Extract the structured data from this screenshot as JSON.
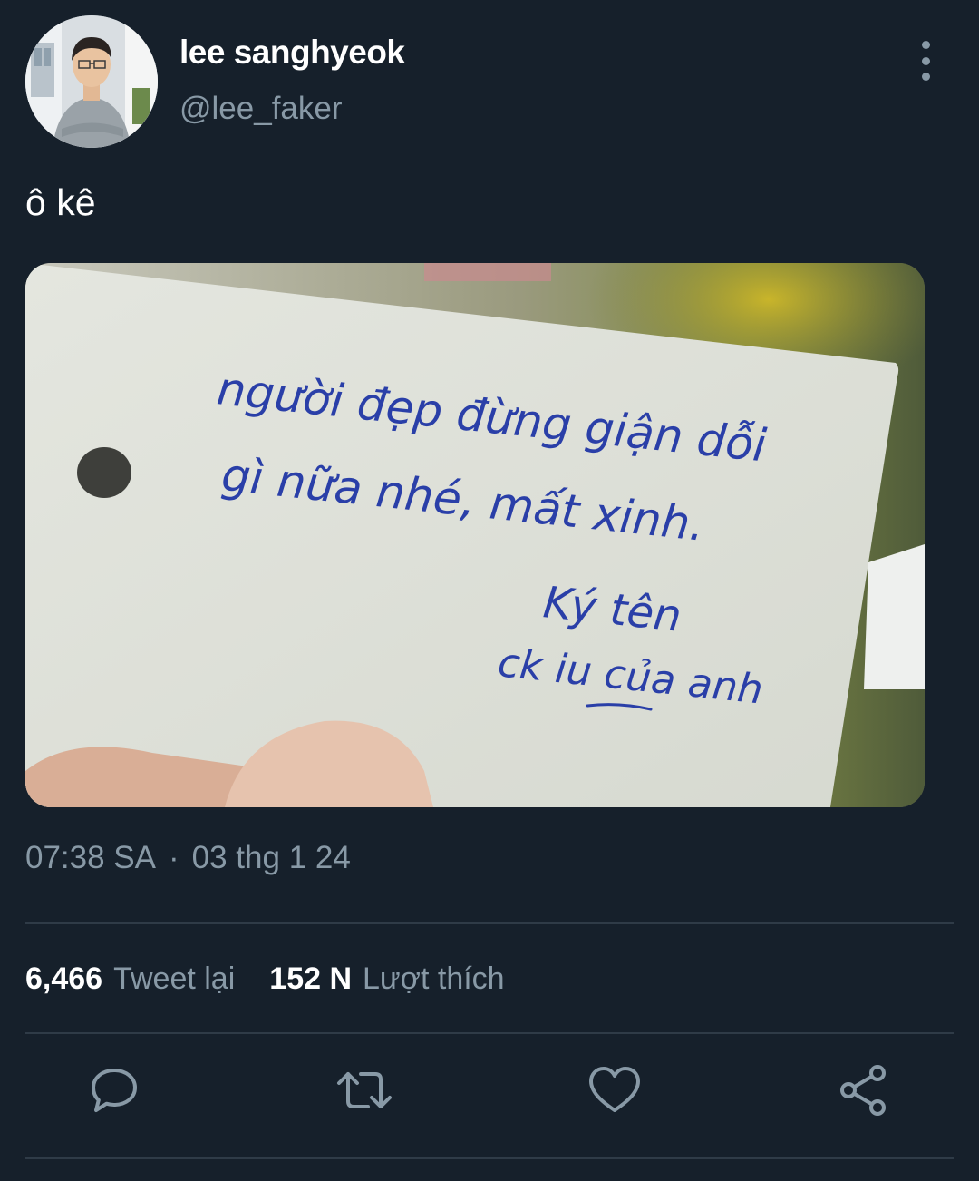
{
  "author": {
    "display_name": "lee sanghyeok",
    "handle": "@lee_faker",
    "avatar_icon": "profile-photo"
  },
  "tweet": {
    "text": "ô kê",
    "media": {
      "handwritten_note": [
        "người đẹp đừng giận dỗi",
        "gì nữa nhé, mất xinh.",
        "Ký tên",
        "ck iu của anh"
      ]
    },
    "time": "07:38 SA",
    "separator": "·",
    "date": "03 thg 1 24"
  },
  "stats": {
    "retweets_count": "6,466",
    "retweets_label": "Tweet lại",
    "likes_count": "152 N",
    "likes_label": "Lượt thích"
  },
  "actions": {
    "reply_icon": "reply-icon",
    "retweet_icon": "retweet-icon",
    "like_icon": "heart-icon",
    "share_icon": "share-icon"
  },
  "colors": {
    "background": "#16202b",
    "secondary_text": "#8899a6",
    "divider": "#2f3b47",
    "ink": "#2a3fa8"
  }
}
